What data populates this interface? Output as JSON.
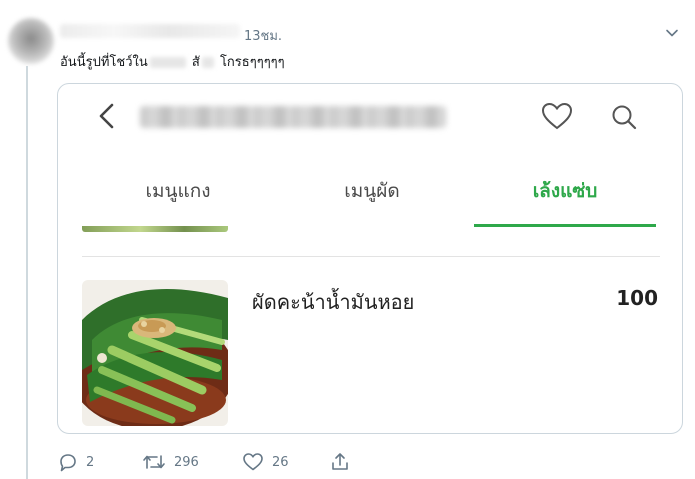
{
  "tweet": {
    "time": "13ชม.",
    "text_part1": "อันนี้รูปที่โชว์ใน",
    "text_part2": "สั",
    "text_part3": "โกรธๆๆๆๆๆ"
  },
  "card": {
    "tabs": [
      {
        "label": "เมนูแกง",
        "active": false
      },
      {
        "label": "เมนูผัด",
        "active": false
      },
      {
        "label": "เล้งแซ่บ",
        "active": true
      }
    ],
    "dish": {
      "name": "ผัดคะน้าน้ำมันหอย",
      "price": "100"
    }
  },
  "actions": {
    "replies": "2",
    "retweets": "296",
    "likes": "26"
  },
  "colors": {
    "accent_green": "#2ea84a",
    "meta_gray": "#657786",
    "border": "#ccd6dd"
  },
  "icons": [
    "chevron-down-icon",
    "back-arrow-icon",
    "heart-icon",
    "search-icon",
    "reply-icon",
    "retweet-icon",
    "like-icon",
    "share-icon"
  ]
}
